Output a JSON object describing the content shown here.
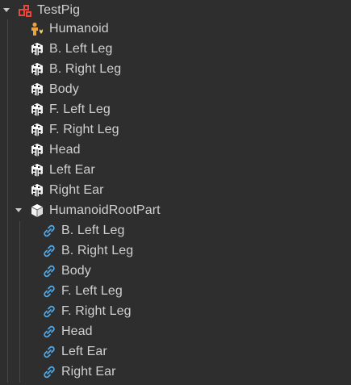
{
  "explorer": {
    "root": {
      "label": "TestPig",
      "icon": "model-icon",
      "expanded": true
    },
    "children": [
      {
        "label": "Humanoid",
        "icon": "humanoid-icon"
      },
      {
        "label": "B. Left Leg",
        "icon": "part-icon"
      },
      {
        "label": "B. Right Leg",
        "icon": "part-icon"
      },
      {
        "label": "Body",
        "icon": "part-icon"
      },
      {
        "label": "F. Left Leg",
        "icon": "part-icon"
      },
      {
        "label": "F. Right Leg",
        "icon": "part-icon"
      },
      {
        "label": "Head",
        "icon": "part-icon"
      },
      {
        "label": "Left Ear",
        "icon": "part-icon"
      },
      {
        "label": "Right Ear",
        "icon": "part-icon"
      }
    ],
    "root_part": {
      "label": "HumanoidRootPart",
      "icon": "root-part-icon",
      "expanded": true
    },
    "joints": [
      {
        "label": "B. Left Leg",
        "icon": "motor-link-icon"
      },
      {
        "label": "B. Right Leg",
        "icon": "motor-link-icon"
      },
      {
        "label": "Body",
        "icon": "motor-link-icon"
      },
      {
        "label": "F. Left Leg",
        "icon": "motor-link-icon"
      },
      {
        "label": "F. Right Leg",
        "icon": "motor-link-icon"
      },
      {
        "label": "Head",
        "icon": "motor-link-icon"
      },
      {
        "label": "Left Ear",
        "icon": "motor-link-icon"
      },
      {
        "label": "Right Ear",
        "icon": "motor-link-icon"
      }
    ]
  }
}
